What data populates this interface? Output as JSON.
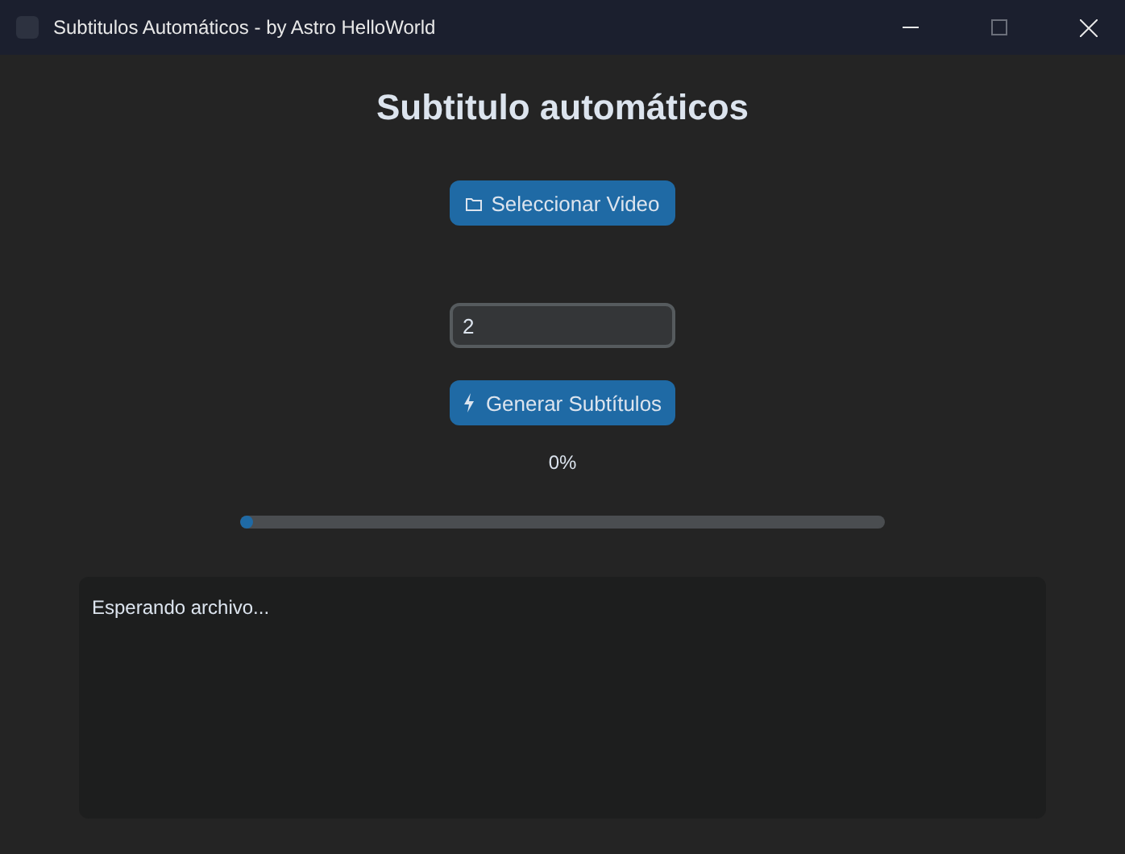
{
  "window": {
    "title": "Subtitulos Automáticos - by Astro HelloWorld"
  },
  "heading": "Subtitulo automáticos",
  "select_button": {
    "label": "Seleccionar Video"
  },
  "input": {
    "value": "2"
  },
  "generate_button": {
    "label": "Generar Subtítulos"
  },
  "progress": {
    "reading": "0%",
    "level": 0.02
  },
  "log": {
    "text": "Esperando archivo..."
  }
}
